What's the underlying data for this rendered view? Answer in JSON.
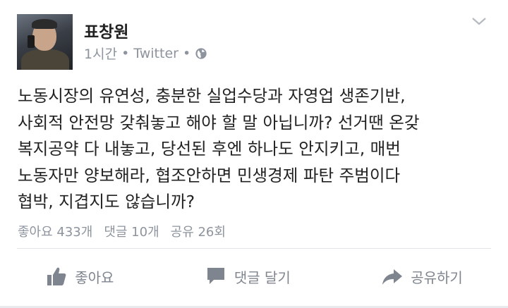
{
  "post": {
    "author": "표창원",
    "time": "1시간",
    "separator": "•",
    "source": "Twitter",
    "lines": [
      "노동시장의 유연성, 충분한 실업수당과 자영업 생존기반,",
      "사회적 안전망 갖춰놓고 해야 할 말 아닙니까? 선거땐 온갖",
      "복지공약 다 내놓고, 당선된 후엔 하나도 안지키고, 매번",
      "노동자만 양보해라, 협조안하면 민생경제 파탄 주범이다",
      "협박, 지겹지도 않습니까?"
    ]
  },
  "stats": {
    "likes": "좋아요 433개",
    "comments": "댓글 10개",
    "shares": "공유 26회"
  },
  "actions": {
    "like_label": "좋아요",
    "comment_label": "댓글 달기",
    "share_label": "공유하기"
  },
  "icons": {
    "menu": "chevron-down-icon",
    "audience": "globe-icon",
    "like": "thumbs-up-icon",
    "comment": "comment-bubble-icon",
    "share": "share-arrow-icon"
  },
  "colors": {
    "text": "#222222",
    "muted": "#8d949e",
    "action": "#7f858f"
  }
}
